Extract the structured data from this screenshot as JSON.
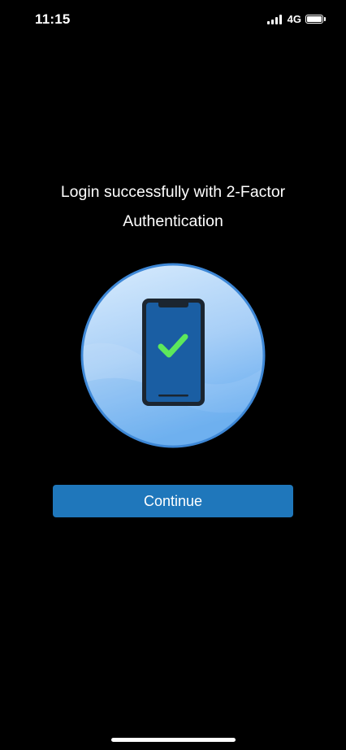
{
  "status_bar": {
    "time": "11:15",
    "network": "4G",
    "signal_icon": "cellular-signal-icon",
    "battery_icon": "battery-icon"
  },
  "message": {
    "text": "Login successfully with 2-Factor Authentication"
  },
  "illustration": {
    "icon": "phone-checkmark-icon",
    "colors": {
      "circle_light": "#d9ecfd",
      "circle_dark": "#6aaef0",
      "circle_border": "#3d87d6",
      "phone_body": "#1b2530",
      "phone_screen": "#1a5ea3",
      "check": "#5de85b"
    }
  },
  "continue_button": {
    "label": "Continue",
    "color": "#1f77bb"
  }
}
